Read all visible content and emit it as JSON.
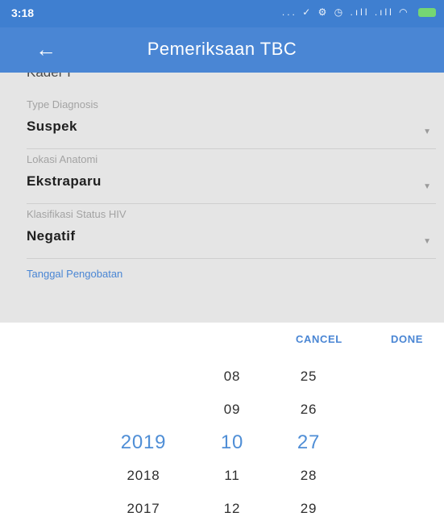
{
  "status": {
    "time": "3:18",
    "icons": "... ✓ ⚙ ◷ .ıll .ıll ◠"
  },
  "appbar": {
    "back": "←",
    "title": "Pemeriksaan TBC"
  },
  "form": {
    "clipped_value": "Kader I",
    "fields": [
      {
        "label": "Type Diagnosis",
        "value": "Suspek"
      },
      {
        "label": "Lokasi Anatomi",
        "value": "Ekstraparu"
      },
      {
        "label": "Klasifikasi Status HIV",
        "value": "Negatif"
      }
    ],
    "date_link": "Tanggal Pengobatan"
  },
  "picker": {
    "cancel": "CANCEL",
    "done": "DONE",
    "year": [
      "",
      "",
      "2019",
      "2018",
      "2017"
    ],
    "month": [
      "08",
      "09",
      "10",
      "11",
      "12"
    ],
    "day": [
      "25",
      "26",
      "27",
      "28",
      "29"
    ],
    "selected_index": 2
  },
  "colors": {
    "accent": "#4a86d4",
    "selected": "#4f8ed6",
    "dim": "#e5e5e5"
  }
}
